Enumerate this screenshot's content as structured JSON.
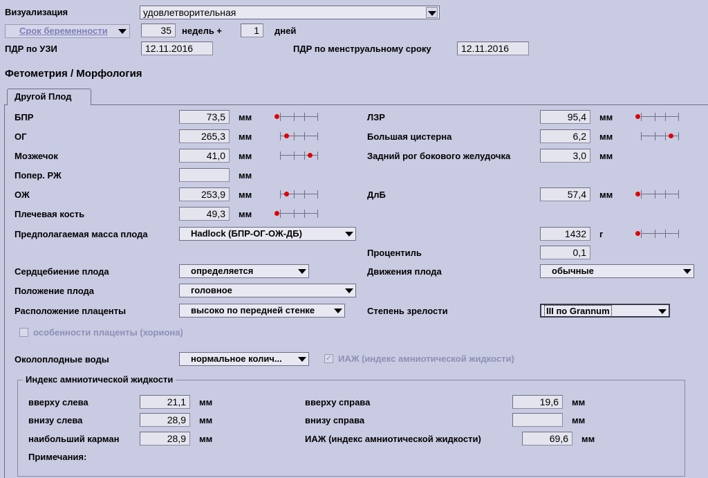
{
  "visualization": {
    "label": "Визуализация",
    "value": "удовлетворительная"
  },
  "gestation": {
    "button_label": "Срок беременности",
    "weeks": "35",
    "weeks_label": "недель +",
    "days": "1",
    "days_label": "дней"
  },
  "edd_us": {
    "label": "ПДР по УЗИ",
    "value": "12.11.2016"
  },
  "edd_lmp": {
    "label": "ПДР по менструальному сроку",
    "value": "12.11.2016"
  },
  "section_title": "Фетометрия / Морфология",
  "tab_label": "Другой Плод",
  "units": {
    "mm": "мм",
    "g": "г"
  },
  "left_measurements": [
    {
      "label": "БПР",
      "value": "73,5"
    },
    {
      "label": "ОГ",
      "value": "265,3"
    },
    {
      "label": "Мозжечок",
      "value": "41,0"
    },
    {
      "label": "Попер. РЖ",
      "value": ""
    },
    {
      "label": "ОЖ",
      "value": "253,9"
    },
    {
      "label": "Плечевая кость",
      "value": "49,3"
    }
  ],
  "right_measurements": [
    {
      "label": "ЛЗР",
      "value": "95,4"
    },
    {
      "label": "Большая цистерна",
      "value": "6,2"
    },
    {
      "label": "Задний рог бокового желудочка",
      "value": "3,0"
    },
    {
      "label": "ДлБ",
      "value": "57,4"
    }
  ],
  "fetal_weight": {
    "label": "Предполагаемая масса плода",
    "method": "Hadlock (БПР-ОГ-ОЖ-ДБ)",
    "value": "1432"
  },
  "percentile": {
    "label": "Процентиль",
    "value": "0,1"
  },
  "heartbeat": {
    "label": "Сердцебиение плода",
    "value": "определяется"
  },
  "movements": {
    "label": "Движения плода",
    "value": "обычные"
  },
  "position": {
    "label": "Положение плода",
    "value": "головное"
  },
  "placenta_location": {
    "label": "Расположение плаценты",
    "value": "высоко по передней стенке"
  },
  "maturity": {
    "label": "Степень зрелости",
    "value": "III по Grannum"
  },
  "placenta_features": {
    "label": "особенности плаценты (хориона)",
    "checked": false
  },
  "amniotic_fluid": {
    "label": "Околоплодные воды",
    "value": "нормальное колич..."
  },
  "afi_checkbox": {
    "label": "ИАЖ (индекс амниотической жидкости)",
    "checked": true
  },
  "afi_group": {
    "title": "Индекс амниотической жидкости",
    "upper_left": {
      "label": "вверху слева",
      "value": "21,1"
    },
    "lower_left": {
      "label": "внизу слева",
      "value": "28,9"
    },
    "largest_pocket": {
      "label": "наибольший карман",
      "value": "28,9"
    },
    "upper_right": {
      "label": "вверху справа",
      "value": "19,6"
    },
    "lower_right": {
      "label": "внизу справа",
      "value": ""
    },
    "afi": {
      "label": "ИАЖ (индекс амниотической жидкости)",
      "value": "69,6"
    },
    "notes_label": "Примечания:"
  },
  "indicators": {
    "bpd": 0.25,
    "hc": 0.42,
    "cerebellum": 0.85,
    "ac": 0.42,
    "humerus": 0.25,
    "ofd": 0.25,
    "cisterna": 0.85,
    "femur": 0.25,
    "weight": 0.25
  },
  "colors": {
    "background": "#c9cbe2",
    "field": "#e4e4ee",
    "indicator": "#e00000",
    "disabled_text": "#8e8fb6"
  }
}
